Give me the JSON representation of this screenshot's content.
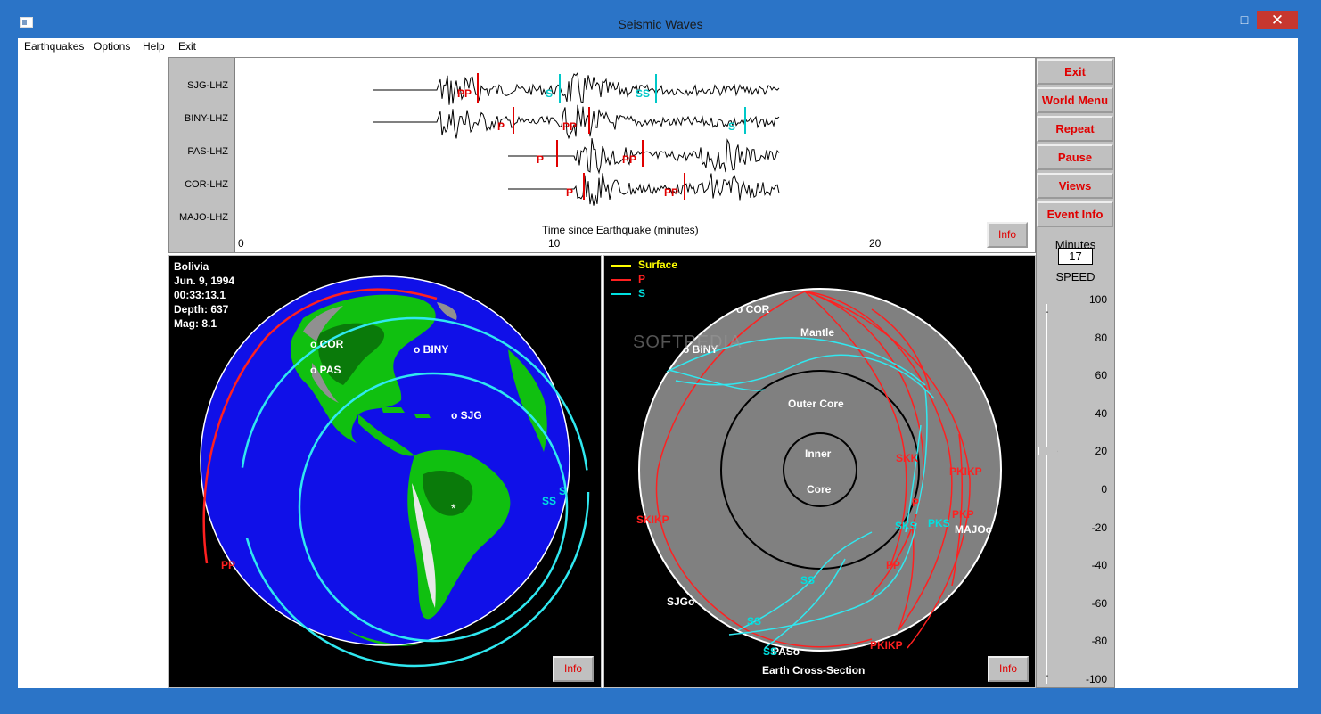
{
  "window": {
    "title": "Seismic Waves"
  },
  "menu": [
    "Earthquakes",
    "Options",
    "Help",
    "Exit"
  ],
  "seismogram": {
    "stations": [
      "SJG-LHZ",
      "BINY-LHZ",
      "PAS-LHZ",
      "COR-LHZ",
      "MAJO-LHZ"
    ],
    "axis_title": "Time since Earthquake (minutes)",
    "ticks": [
      "0",
      "10",
      "20"
    ],
    "phase_marks": [
      {
        "label": "PP",
        "color": "#e00000"
      },
      {
        "label": "S",
        "color": "#00c8c8"
      },
      {
        "label": "SS",
        "color": "#00c8c8"
      },
      {
        "label": "P",
        "color": "#e00000"
      },
      {
        "label": "PP",
        "color": "#e00000"
      },
      {
        "label": "S",
        "color": "#00c8c8"
      },
      {
        "label": "P",
        "color": "#e00000"
      },
      {
        "label": "PP",
        "color": "#e00000"
      },
      {
        "label": "P",
        "color": "#e00000"
      },
      {
        "label": "PP",
        "color": "#e00000"
      }
    ],
    "info_label": "Info"
  },
  "controls": {
    "buttons": [
      "Exit",
      "World Menu",
      "Repeat",
      "Pause",
      "Views",
      "Event Info"
    ],
    "minutes_label": "Minutes",
    "minutes_value": "17",
    "speed_label": "SPEED",
    "speed_scale": [
      "100",
      "80",
      "60",
      "40",
      "20",
      "0",
      "-20",
      "-40",
      "-60",
      "-80",
      "-100"
    ],
    "speed_value": 20
  },
  "globe": {
    "event": {
      "location": "Bolivia",
      "date": "Jun. 9, 1994",
      "time": "00:33:13.1",
      "depth": "Depth:  637",
      "mag": "Mag:  8.1"
    },
    "stations": [
      "o COR",
      "o PAS",
      "o BINY",
      "o SJG"
    ],
    "wave_labels": [
      {
        "text": "SS",
        "color": "#00e0e0"
      },
      {
        "text": "S",
        "color": "#00e0e0"
      },
      {
        "text": "PP",
        "color": "#ff2020"
      }
    ],
    "info_label": "Info"
  },
  "cross_section": {
    "legend": [
      {
        "label": "Surface",
        "color": "#ffff00"
      },
      {
        "label": "P",
        "color": "#ff2020"
      },
      {
        "label": "S",
        "color": "#00e0e0"
      }
    ],
    "layers": [
      "Mantle",
      "Outer Core",
      "Inner",
      "Core"
    ],
    "stations": [
      "o COR",
      "o BINY",
      "SJGo",
      "MAJOo",
      "PASo"
    ],
    "phase_labels": [
      {
        "text": "SKIKP",
        "color": "#ff2020"
      },
      {
        "text": "SKK",
        "color": "#ff2020"
      },
      {
        "text": "PKIKP",
        "color": "#ff2020"
      },
      {
        "text": "PKP",
        "color": "#ff2020"
      },
      {
        "text": "PP",
        "color": "#ff2020"
      },
      {
        "text": "PKIKP",
        "color": "#ff2020"
      },
      {
        "text": "SKS",
        "color": "#00e0e0"
      },
      {
        "text": "PKS",
        "color": "#00e0e0"
      },
      {
        "text": "SS",
        "color": "#00e0e0"
      },
      {
        "text": "SS",
        "color": "#00e0e0"
      },
      {
        "text": "SS",
        "color": "#00e0e0"
      },
      {
        "text": "P",
        "color": "#ff2020"
      }
    ],
    "caption": "Earth Cross-Section",
    "watermark": "SOFTPEDIA",
    "info_label": "Info"
  }
}
